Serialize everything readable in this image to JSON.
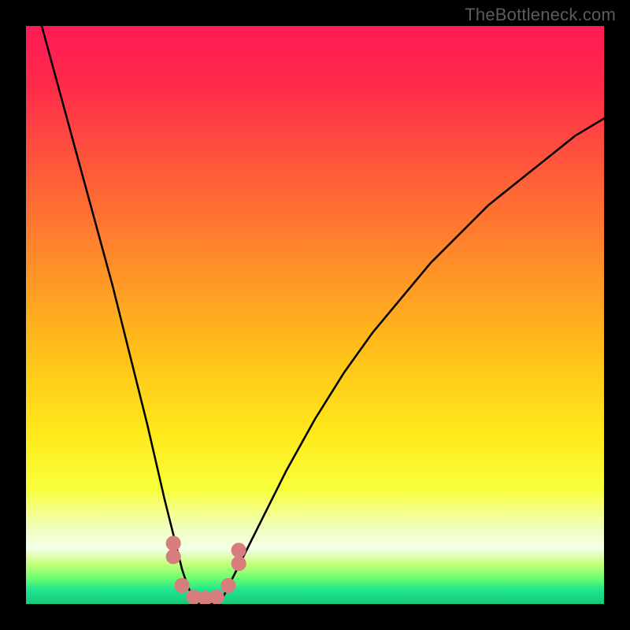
{
  "watermark": "TheBottleneck.com",
  "chart_data": {
    "type": "line",
    "title": "",
    "xlabel": "",
    "ylabel": "",
    "xlim": [
      0,
      100
    ],
    "ylim": [
      0,
      100
    ],
    "series": [
      {
        "name": "bottleneck-curve",
        "x": [
          0,
          3,
          6,
          9,
          12,
          15,
          18,
          21,
          24,
          27,
          28,
          29,
          30,
          31,
          32,
          33,
          34,
          35,
          37,
          40,
          45,
          50,
          55,
          60,
          65,
          70,
          75,
          80,
          85,
          90,
          95,
          100
        ],
        "values": [
          110,
          99,
          88,
          77,
          66,
          55,
          43,
          31,
          18,
          6,
          3,
          1,
          0,
          0,
          0,
          0,
          1,
          3,
          7,
          13,
          23,
          32,
          40,
          47,
          53,
          59,
          64,
          69,
          73,
          77,
          81,
          84
        ]
      }
    ],
    "markers": {
      "name": "valley-dots",
      "color": "#d87d7d",
      "radius_pct": 1.3,
      "points": [
        {
          "x": 25.5,
          "y": 10.5
        },
        {
          "x": 25.5,
          "y": 8.2
        },
        {
          "x": 27.0,
          "y": 3.2
        },
        {
          "x": 29.0,
          "y": 1.2
        },
        {
          "x": 31.0,
          "y": 1.0
        },
        {
          "x": 33.0,
          "y": 1.2
        },
        {
          "x": 35.0,
          "y": 3.2
        },
        {
          "x": 36.8,
          "y": 7.0
        },
        {
          "x": 36.8,
          "y": 9.3
        }
      ]
    },
    "gradient_stops": [
      {
        "offset": 0.0,
        "color": "#ff1a55"
      },
      {
        "offset": 0.1,
        "color": "#ff2a4a"
      },
      {
        "offset": 0.25,
        "color": "#ff5a3a"
      },
      {
        "offset": 0.4,
        "color": "#ff8a2a"
      },
      {
        "offset": 0.55,
        "color": "#ffbb1a"
      },
      {
        "offset": 0.7,
        "color": "#ffe81a"
      },
      {
        "offset": 0.8,
        "color": "#f8ff3a"
      },
      {
        "offset": 0.87,
        "color": "#f0ffc0"
      },
      {
        "offset": 0.905,
        "color": "#f4ffe8"
      },
      {
        "offset": 0.93,
        "color": "#c6ff7a"
      },
      {
        "offset": 0.955,
        "color": "#6eff6e"
      },
      {
        "offset": 0.975,
        "color": "#1fe68f"
      },
      {
        "offset": 1.0,
        "color": "#18c97a"
      }
    ]
  }
}
